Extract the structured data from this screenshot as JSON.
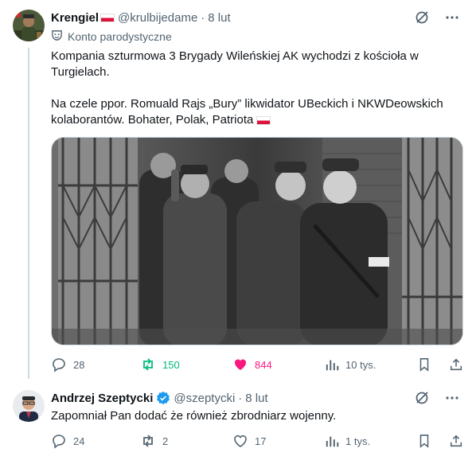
{
  "tweet1": {
    "author_name": "Krengiel",
    "handle": "@krulbijedame",
    "dot": "·",
    "time": "8 lut",
    "label": "Konto parodystyczne",
    "text_line1": "Kompania szturmowa 3 Brygady Wileńskiej AK wychodzi z kościoła w Turgielach.",
    "text_line2": "Na czele ppor. Romuald Rajs „Bury” likwidator UBeckich i NKWDeowskich kolaborantów. Bohater, Polak, Patriota",
    "stats": {
      "replies": "28",
      "reposts": "150",
      "likes": "844",
      "views": "10 tys."
    }
  },
  "tweet2": {
    "author_name": "Andrzej Szeptycki",
    "handle": "@szeptycki",
    "dot": "·",
    "time": "8 lut",
    "text": "Zapomniał Pan dodać że również zbrodniarz wojenny.",
    "stats": {
      "replies": "24",
      "reposts": "2",
      "likes": "17",
      "views": "1 tys."
    }
  },
  "colors": {
    "text": "#0f1419",
    "muted": "#536471",
    "repost_active": "#00ba7c",
    "like_active": "#f91880",
    "verified": "#1d9bf0",
    "flag_white": "#ffffff",
    "flag_red": "#dc143c"
  },
  "icons": [
    "grok-icon",
    "more-icon",
    "parody-mask-icon",
    "reply-icon",
    "repost-icon",
    "like-icon",
    "views-icon",
    "bookmark-icon",
    "share-icon",
    "verified-badge-icon",
    "poland-flag-icon"
  ]
}
